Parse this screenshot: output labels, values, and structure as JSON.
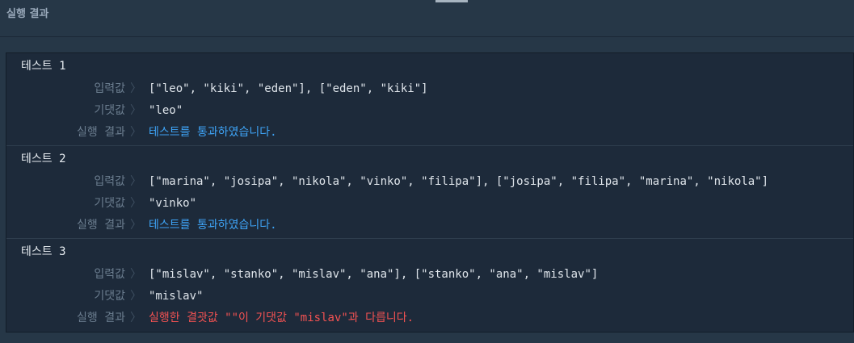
{
  "header": {
    "title": "실행 결과"
  },
  "labels": {
    "input": "입력값",
    "expected": "기댓값",
    "result": "실행 결과",
    "separator": "〉"
  },
  "tests": [
    {
      "title": "테스트 1",
      "input": "[\"leo\", \"kiki\", \"eden\"], [\"eden\", \"kiki\"]",
      "expected": "\"leo\"",
      "result": "테스트를 통과하였습니다.",
      "status": "pass"
    },
    {
      "title": "테스트 2",
      "input": "[\"marina\", \"josipa\", \"nikola\", \"vinko\", \"filipa\"], [\"josipa\", \"filipa\", \"marina\", \"nikola\"]",
      "expected": "\"vinko\"",
      "result": "테스트를 통과하였습니다.",
      "status": "pass"
    },
    {
      "title": "테스트 3",
      "input": "[\"mislav\", \"stanko\", \"mislav\", \"ana\"], [\"stanko\", \"ana\", \"mislav\"]",
      "expected": "\"mislav\"",
      "result": "실행한 결괏값 \"\"이 기댓값 \"mislav\"과 다릅니다.",
      "status": "fail"
    }
  ],
  "colors": {
    "pass": "#3ea3f5",
    "fail": "#f25252",
    "background": "#263747",
    "panel": "#1d2a3a"
  }
}
